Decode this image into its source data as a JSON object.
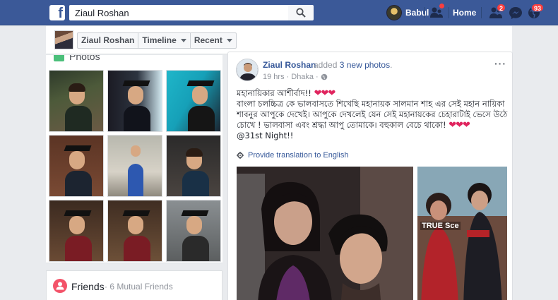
{
  "topbar": {
    "logo": "f",
    "search_value": "Ziaul Roshan",
    "search_placeholder": "Search",
    "username": "Babul",
    "home_label": "Home",
    "friend_requests_count": "2",
    "notifications_count": "93",
    "accent": "#3b5998"
  },
  "subnav": {
    "profile_name": "Ziaul Roshan",
    "timeline_label": "Timeline",
    "recent_label": "Recent"
  },
  "photos": {
    "title": "Photos",
    "count": 9
  },
  "friends": {
    "title": "Friends",
    "subtitle": "· 6 Mutual Friends"
  },
  "post": {
    "author": "Ziaul Roshan",
    "action_prefix": "added",
    "action_link": "3 new photos",
    "action_suffix": ".",
    "time": "19 hrs",
    "location": "Dhaka",
    "line1": "মহানায়িকার আশীর্বাদ!!",
    "line2": "বাংলা চলচ্চিত্র কে ভালবাসতে শিখেছি মহানায়ক সালমান শাহ এর সেই মহান নায়িকা শাবনুর আপুকে দেখেই। আপুকে দেখলেই যেন সেই মহানায়কের চেহারাটাই ভেসে উঠে চোখে ! ভালবাসা এবং শ্রদ্ধা আপু তোমাকে। বহুকাল বেচে থাকো!",
    "line3": "@31st Night!!",
    "hearts": "❤❤❤",
    "translate_label": "Provide translation to English",
    "poster_text": "TRUE Sce"
  }
}
